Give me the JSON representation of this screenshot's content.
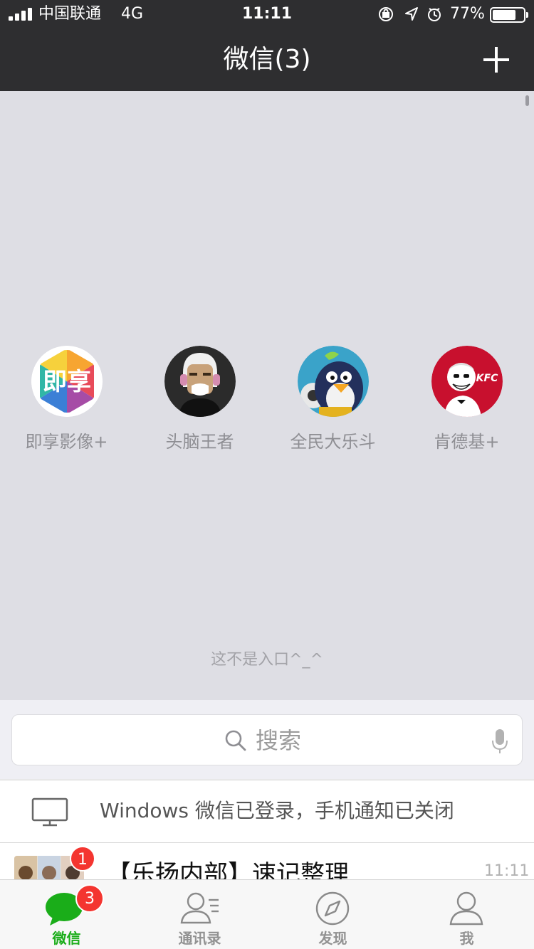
{
  "status_bar": {
    "carrier": "中国联通",
    "network": "4G",
    "time": "11:11",
    "battery_percent": "77%",
    "battery_level": 0.77,
    "icons": [
      "orientation-lock-icon",
      "location-icon",
      "alarm-icon"
    ]
  },
  "nav": {
    "title": "微信(3)",
    "plus_icon": "plus-icon"
  },
  "mini_programs": {
    "apps": [
      {
        "name": "即享影像+",
        "icon": "jixiang-app-icon",
        "icon_text": "即享"
      },
      {
        "name": "头脑王者",
        "icon": "tounao-app-icon"
      },
      {
        "name": "全民大乐斗",
        "icon": "dalledou-app-icon"
      },
      {
        "name": "肯德基+",
        "icon": "kfc-app-icon",
        "icon_text": "KFC"
      }
    ],
    "hint": "这不是入口^_^"
  },
  "search": {
    "placeholder": "搜索",
    "icon": "search-icon",
    "voice_icon": "microphone-icon"
  },
  "notice": {
    "icon": "monitor-icon",
    "text": "Windows 微信已登录，手机通知已关闭"
  },
  "chats": [
    {
      "title": "【乐扬内部】速记整理",
      "time": "11:11",
      "unread": "1"
    }
  ],
  "tab_bar": {
    "tabs": [
      {
        "label": "微信",
        "icon": "chat-bubble-icon",
        "badge": "3",
        "active": true
      },
      {
        "label": "通讯录",
        "icon": "contacts-icon"
      },
      {
        "label": "发现",
        "icon": "compass-icon"
      },
      {
        "label": "我",
        "icon": "person-icon"
      }
    ]
  },
  "colors": {
    "accent": "#1aad19",
    "badge": "#f43530",
    "nav_background": "#2e2e30"
  }
}
